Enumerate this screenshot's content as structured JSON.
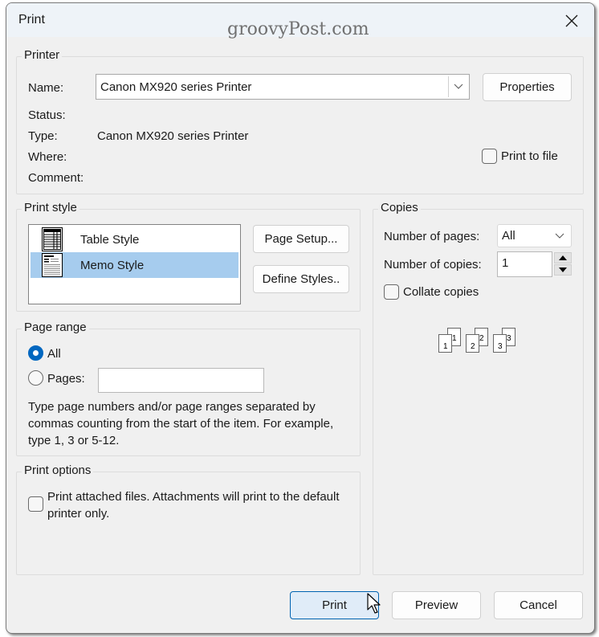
{
  "window": {
    "title": "Print",
    "watermark": "groovyPost.com",
    "close_icon": "close-icon"
  },
  "printer": {
    "group_label": "Printer",
    "name_label": "Name:",
    "name_value": "Canon MX920 series Printer",
    "properties_label": "Properties",
    "status_label": "Status:",
    "status_value": "",
    "type_label": "Type:",
    "type_value": "Canon MX920 series Printer",
    "where_label": "Where:",
    "where_value": "",
    "comment_label": "Comment:",
    "comment_value": "",
    "print_to_file_label": "Print to file",
    "print_to_file_checked": false
  },
  "print_style": {
    "group_label": "Print style",
    "items": [
      {
        "label": "Table Style",
        "icon": "table-style-icon",
        "selected": false
      },
      {
        "label": "Memo Style",
        "icon": "memo-style-icon",
        "selected": true
      }
    ],
    "page_setup_label": "Page Setup...",
    "define_styles_label": "Define Styles.."
  },
  "copies": {
    "group_label": "Copies",
    "number_of_pages_label": "Number of pages:",
    "number_of_pages_value": "All",
    "number_of_copies_label": "Number of copies:",
    "number_of_copies_value": "1",
    "collate_label": "Collate copies",
    "collate_checked": false,
    "collate_preview": [
      "1",
      "1",
      "2",
      "2",
      "3",
      "3"
    ]
  },
  "page_range": {
    "group_label": "Page range",
    "all_label": "All",
    "all_selected": true,
    "pages_label": "Pages:",
    "pages_value": "",
    "description": "Type page numbers and/or page ranges separated by commas counting from the start of the item.  For example, type 1, 3 or 5-12."
  },
  "print_options": {
    "group_label": "Print options",
    "attachments_label": "Print attached files.  Attachments will print to the default printer only.",
    "attachments_checked": false
  },
  "footer": {
    "print_label": "Print",
    "preview_label": "Preview",
    "cancel_label": "Cancel"
  }
}
